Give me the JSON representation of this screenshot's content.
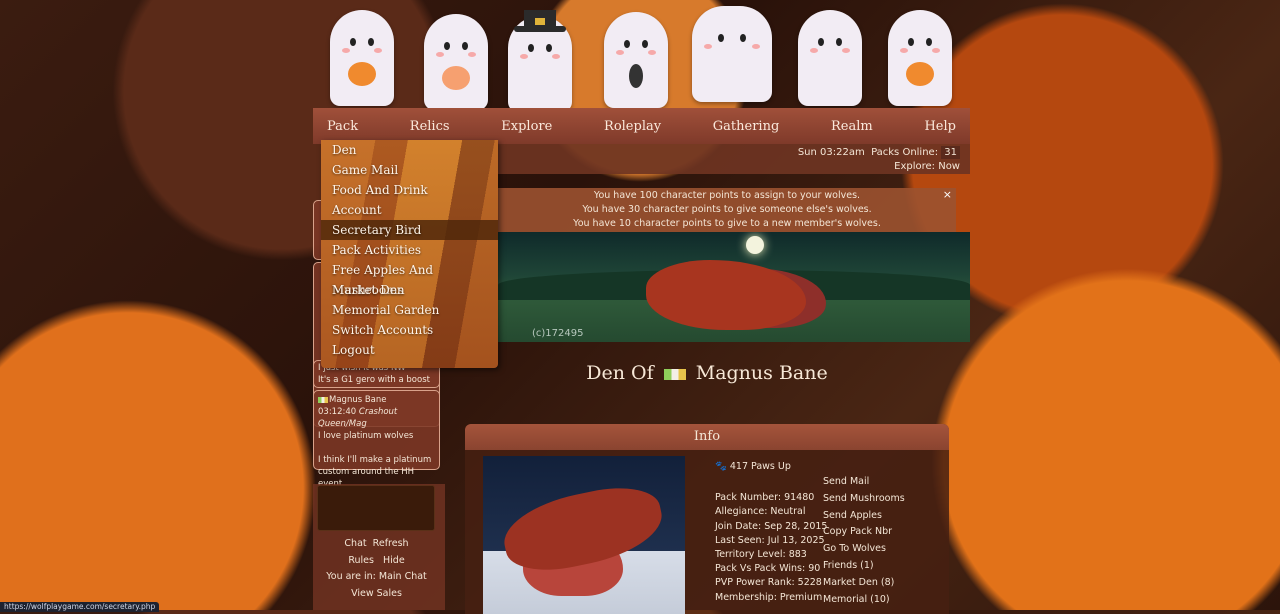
{
  "nav": [
    "Pack",
    "Relics",
    "Explore",
    "Roleplay",
    "Gathering",
    "Realm",
    "Help"
  ],
  "status": {
    "time": "Sun 03:22am",
    "packs_online_label": "Packs Online:",
    "packs_online": "31",
    "explore": "Explore: Now"
  },
  "notices": [
    "You have 100 character points to assign to your wolves.",
    "You have 30 character points to give someone else's wolves.",
    "You have 10 character points to give to a new member's wolves."
  ],
  "notice_close": "×",
  "banner_signature": "(c)172495",
  "den": {
    "prefix": "Den Of",
    "name": "Magnus Bane"
  },
  "info": {
    "header": "Info",
    "paws": "417 Paws Up",
    "stats": [
      "Pack Number: 91480",
      "Allegiance: Neutral",
      "Join Date: Sep 28, 2015",
      "Last Seen: Jul 13, 2025",
      "Territory Level: 883",
      "Pack Vs Pack Wins: 90",
      "PVP Power Rank: 5228",
      "Membership: Premium"
    ],
    "actions": [
      "Send Mail",
      "Send Mushrooms",
      "Send Apples",
      "Copy Pack Nbr",
      "Go To Wolves",
      "Friends (1)",
      "Market Den (8)",
      "Memorial (10)"
    ]
  },
  "dropdown": [
    "Den",
    "Game Mail",
    "Food And Drink",
    "Account",
    "Secretary Bird",
    "Pack Activities",
    "Free Apples And Mushrooms",
    "Market Den",
    "Memorial Garden",
    "Switch Accounts",
    "Logout"
  ],
  "chat": {
    "partial1": [
      "I just wish it was NW",
      "It's a G1 gero with a boost"
    ],
    "msg2": {
      "name": "Magnus Bane",
      "time": "03:12:40",
      "title": "Crashout Queen/Mag",
      "lines": [
        "I love platinum wolves",
        "",
        "I think I'll make a platinum custom around the HH event"
      ]
    },
    "controls": {
      "chat": "Chat",
      "refresh": "Refresh",
      "rules": "Rules",
      "hide": "Hide",
      "room": "You are in: Main Chat",
      "sales": "View Sales"
    }
  },
  "status_url": "https://wolfplaygame.com/secretary.php"
}
